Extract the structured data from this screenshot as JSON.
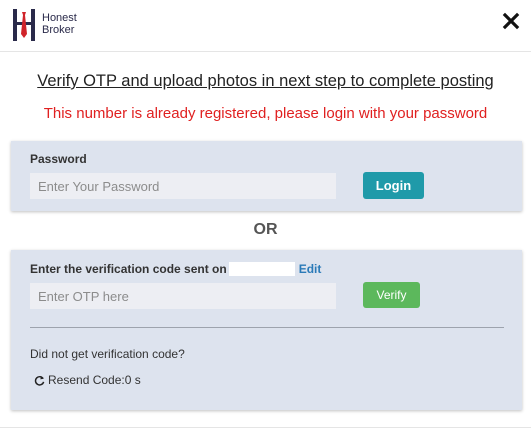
{
  "brand": {
    "name_line1": "Honest",
    "name_line2": "Broker",
    "colors": {
      "navy": "#2a2a4a",
      "red": "#d0232a"
    }
  },
  "header": {
    "close_icon": "close-icon"
  },
  "headline": "Verify OTP and upload photos in next step to complete posting",
  "warning": "This number is already registered, please login with your password",
  "password_section": {
    "label": "Password",
    "placeholder": "Enter Your Password",
    "value": "",
    "login_label": "Login"
  },
  "separator": "OR",
  "otp_section": {
    "label": "Enter the verification code sent on",
    "edit_label": "Edit",
    "placeholder": "Enter OTP here",
    "value": "",
    "verify_label": "Verify",
    "not_received": "Did not get verification code?",
    "resend_label": "Resend Code:0 s",
    "resend_icon": "refresh-icon"
  },
  "colors": {
    "panel_bg": "#dde3ee",
    "login_btn": "#1f9aa9",
    "verify_btn": "#5cb85c",
    "warning_text": "#e02020",
    "edit_link": "#2a7ab8"
  }
}
